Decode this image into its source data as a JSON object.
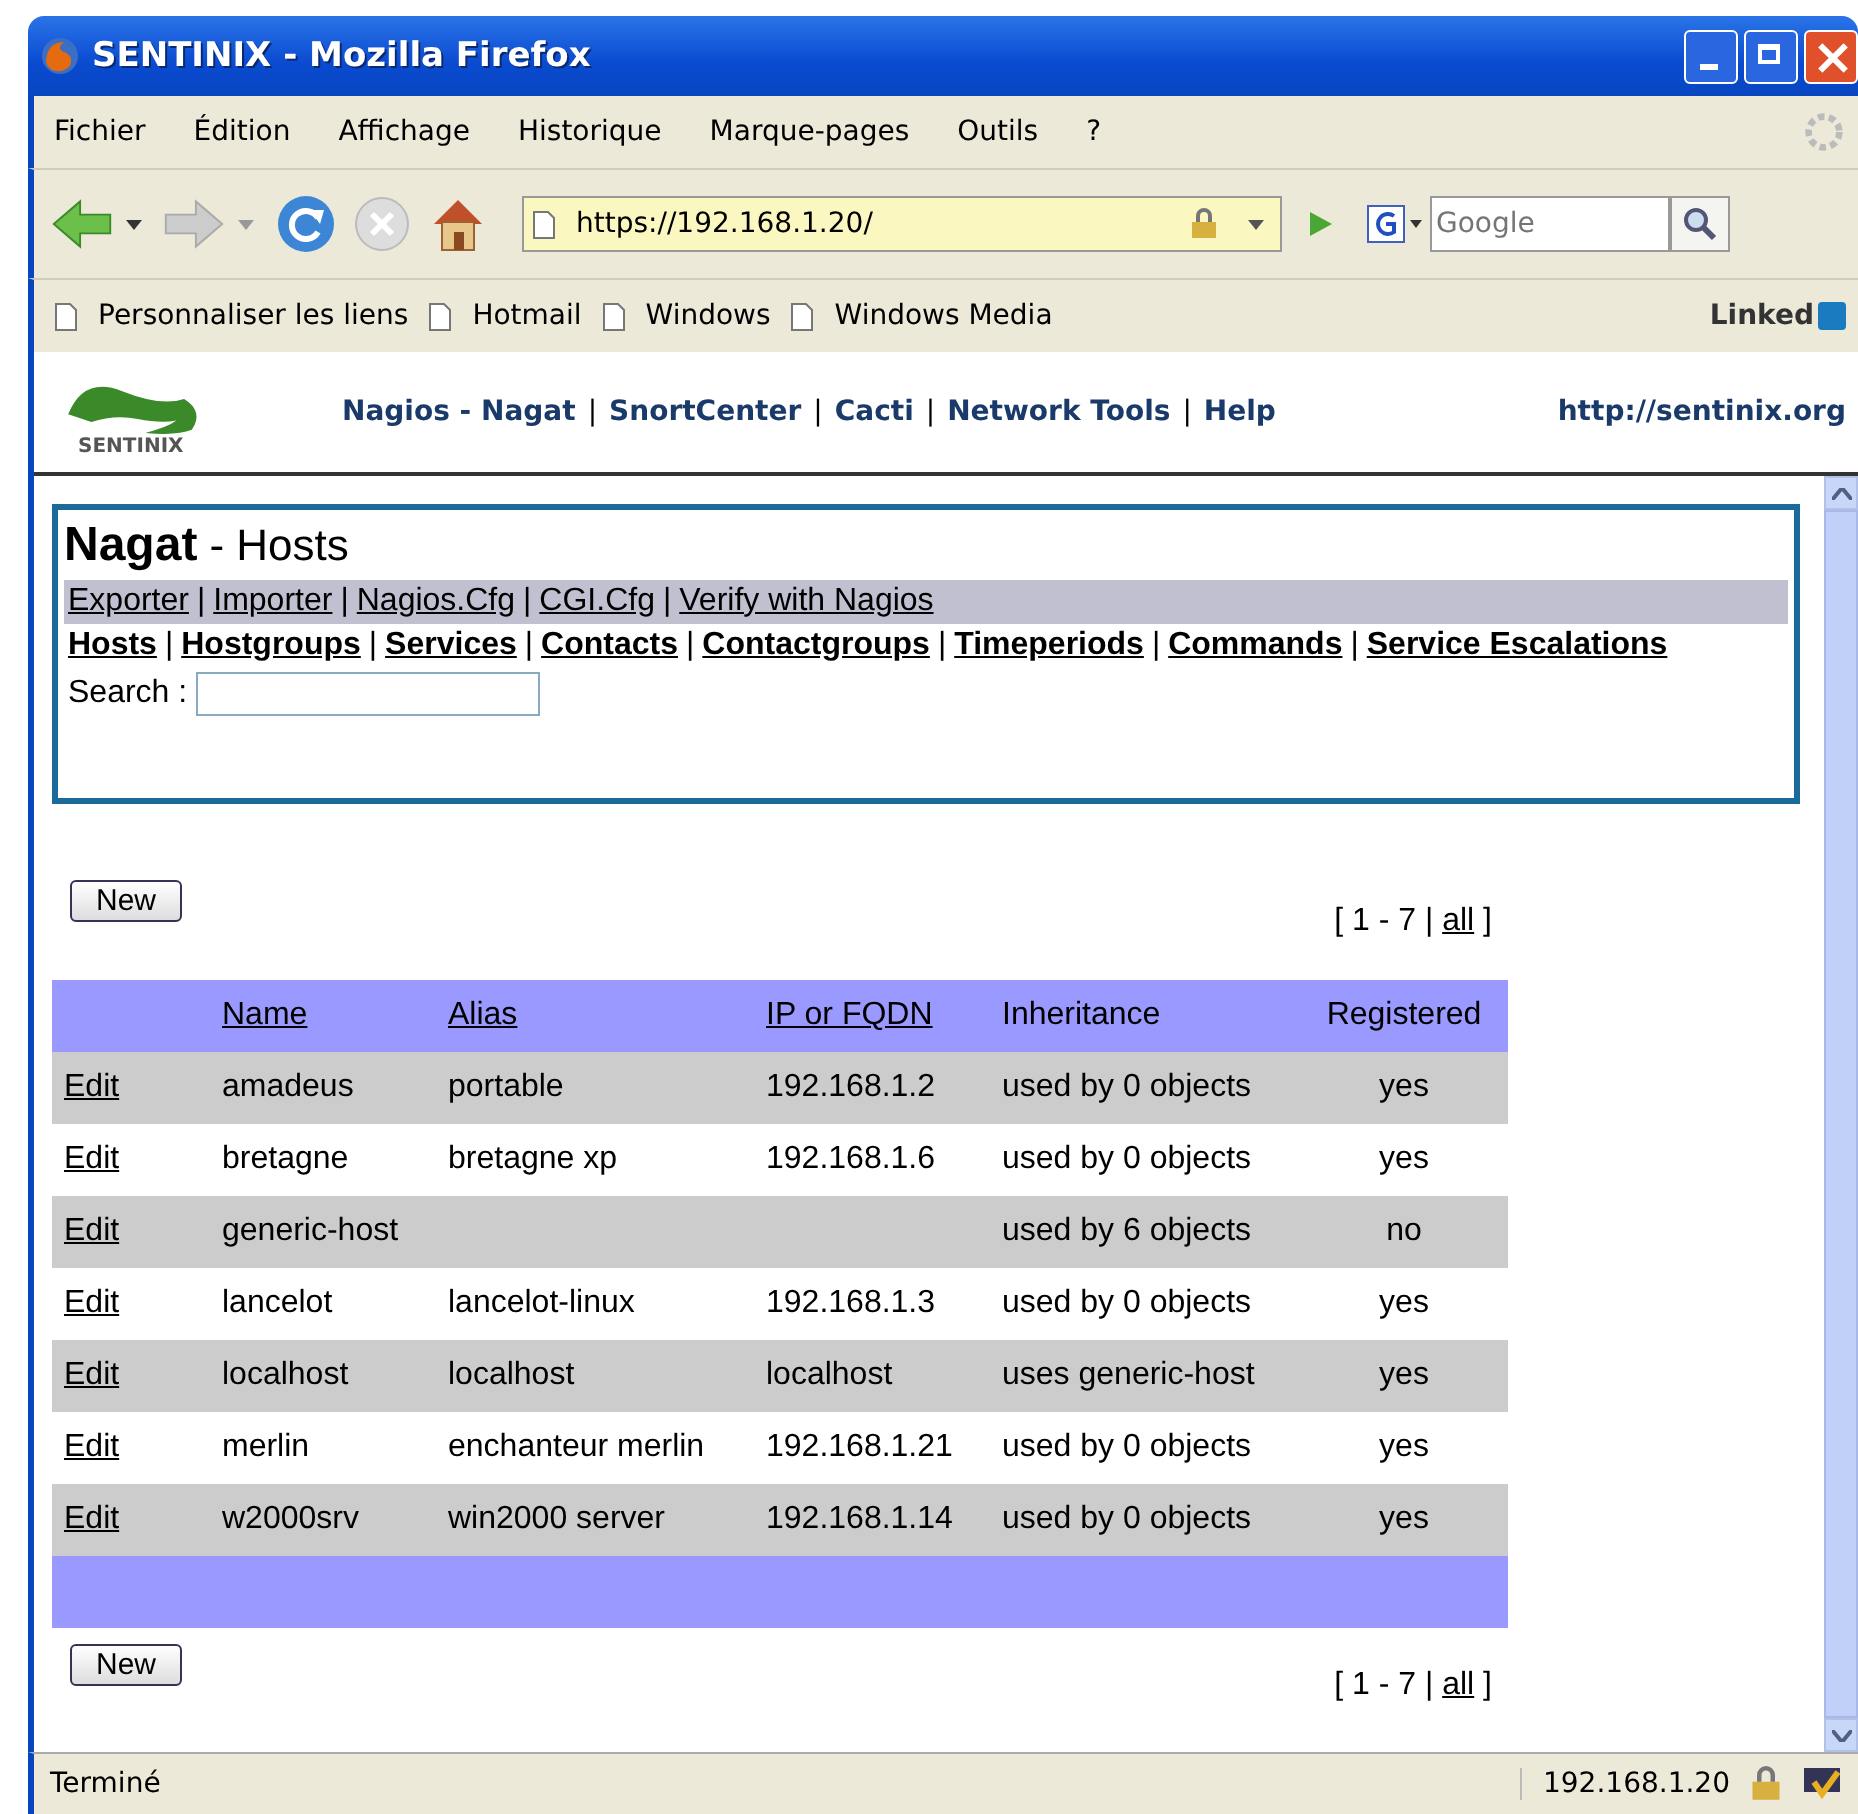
{
  "window": {
    "title": "SENTINIX - Mozilla Firefox"
  },
  "menu": [
    "Fichier",
    "Édition",
    "Affichage",
    "Historique",
    "Marque-pages",
    "Outils",
    "?"
  ],
  "address": {
    "value": "https://192.168.1.20/"
  },
  "search": {
    "placeholder": "Google"
  },
  "bookmarks": [
    "Personnaliser les liens",
    "Hotmail",
    "Windows",
    "Windows Media"
  ],
  "bookmark_logo": "Linked",
  "header": {
    "logo_text": "SENTINIX",
    "nav": [
      {
        "kind": "link",
        "text": "Nagios - Nagat"
      },
      {
        "kind": "separator",
        "text": "|"
      },
      {
        "kind": "link",
        "text": "SnortCenter"
      },
      {
        "kind": "separator",
        "text": "|"
      },
      {
        "kind": "link",
        "text": "Cacti"
      },
      {
        "kind": "separator",
        "text": "|"
      },
      {
        "kind": "link",
        "text": "Network Tools"
      },
      {
        "kind": "separator",
        "text": "|"
      },
      {
        "kind": "link",
        "text": "Help"
      }
    ],
    "site": "http://sentinix.org"
  },
  "panel": {
    "title": "Nagat",
    "subtitle": "- Hosts",
    "tools": [
      {
        "kind": "link",
        "text": "Exporter"
      },
      {
        "kind": "separator",
        "text": "|"
      },
      {
        "kind": "link",
        "text": "Importer"
      },
      {
        "kind": "separator",
        "text": "|"
      },
      {
        "kind": "link",
        "text": "Nagios.Cfg"
      },
      {
        "kind": "separator",
        "text": "|"
      },
      {
        "kind": "link",
        "text": "CGI.Cfg"
      },
      {
        "kind": "separator",
        "text": "|"
      },
      {
        "kind": "link",
        "text": "Verify with Nagios"
      }
    ],
    "sections": [
      {
        "kind": "link",
        "text": "Hosts"
      },
      {
        "kind": "separator",
        "text": "|"
      },
      {
        "kind": "link",
        "text": "Hostgroups"
      },
      {
        "kind": "separator",
        "text": "|"
      },
      {
        "kind": "link",
        "text": "Services"
      },
      {
        "kind": "separator",
        "text": "|"
      },
      {
        "kind": "link",
        "text": "Contacts"
      },
      {
        "kind": "separator",
        "text": "|"
      },
      {
        "kind": "link",
        "text": "Contactgroups"
      },
      {
        "kind": "separator",
        "text": "|"
      },
      {
        "kind": "link",
        "text": "Timeperiods"
      },
      {
        "kind": "separator",
        "text": "|"
      },
      {
        "kind": "link",
        "text": "Commands"
      },
      {
        "kind": "separator",
        "text": "|"
      },
      {
        "kind": "link",
        "text": "Service Escalations"
      }
    ],
    "search_label": "Search :"
  },
  "top_bar": {
    "new_button": "New",
    "pager": {
      "range": "[ 1 - 7 |",
      "all": "all",
      "close": "]"
    }
  },
  "table": {
    "columns": [
      {
        "label": "Name",
        "link": true
      },
      {
        "label": "Alias",
        "link": true
      },
      {
        "label": "IP or FQDN",
        "link": true
      },
      {
        "label": "Inheritance",
        "link": false
      },
      {
        "label": "Registered",
        "link": false
      }
    ],
    "rows": [
      {
        "action": "Edit",
        "cells": [
          "amadeus",
          "portable",
          "192.168.1.2",
          "used by 0 objects",
          "yes"
        ]
      },
      {
        "action": "Edit",
        "cells": [
          "bretagne",
          "bretagne xp",
          "192.168.1.6",
          "used by 0 objects",
          "yes"
        ]
      },
      {
        "action": "Edit",
        "cells": [
          "generic-host",
          "",
          "",
          "used by 6 objects",
          "no"
        ]
      },
      {
        "action": "Edit",
        "cells": [
          "lancelot",
          "lancelot-linux",
          "192.168.1.3",
          "used by 0 objects",
          "yes"
        ]
      },
      {
        "action": "Edit",
        "cells": [
          "localhost",
          "localhost",
          "localhost",
          "uses generic-host",
          "yes"
        ]
      },
      {
        "action": "Edit",
        "cells": [
          "merlin",
          "enchanteur merlin",
          "192.168.1.21",
          "used by 0 objects",
          "yes"
        ]
      },
      {
        "action": "Edit",
        "cells": [
          "w2000srv",
          "win2000 server",
          "192.168.1.14",
          "used by 0 objects",
          "yes"
        ]
      }
    ]
  },
  "bottom_bar": {
    "new_button": "New",
    "pager": {
      "range": "[ 1 - 7 |",
      "all": "all",
      "close": "]"
    }
  },
  "status_bar": {
    "text": "Terminé",
    "host": "192.168.1.20"
  }
}
